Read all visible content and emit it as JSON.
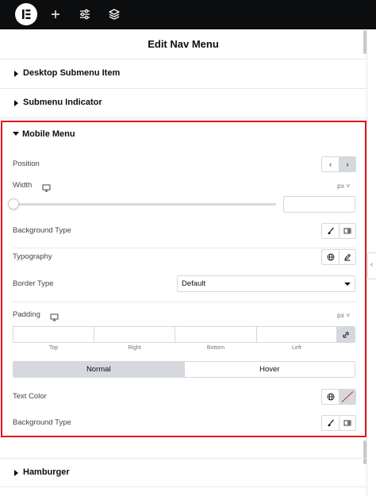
{
  "topbar": {
    "logo_icon": "elementor-logo-icon",
    "add_icon": "plus-icon",
    "settings_icon": "sliders-icon",
    "structure_icon": "layers-icon"
  },
  "panel": {
    "title": "Edit Nav Menu"
  },
  "sections": {
    "desktop_submenu": "Desktop Submenu Item",
    "submenu_indicator": "Submenu Indicator",
    "mobile_menu": "Mobile Menu",
    "hamburger": "Hamburger"
  },
  "mobile_menu": {
    "position": {
      "label": "Position",
      "options": [
        "‹",
        "›"
      ],
      "selected": "›"
    },
    "width": {
      "label": "Width",
      "unit": "px",
      "device_icon": "desktop-icon",
      "value": "",
      "slider_value": 0
    },
    "background_type_1": {
      "label": "Background Type",
      "icons": [
        "brush-icon",
        "gradient-icon"
      ]
    },
    "typography": {
      "label": "Typography",
      "icons": [
        "globe-icon",
        "pencil-icon"
      ]
    },
    "border_type": {
      "label": "Border Type",
      "value": "Default"
    },
    "padding": {
      "label": "Padding",
      "unit": "px",
      "device_icon": "desktop-icon",
      "fields": [
        "Top",
        "Right",
        "Bottom",
        "Left"
      ],
      "link_icon": "link-icon"
    },
    "state_tabs": [
      "Normal",
      "Hover"
    ],
    "active_state": "Normal",
    "text_color": {
      "label": "Text Color",
      "icons": [
        "globe-icon",
        "no-color-swatch-icon"
      ]
    },
    "background_type_2": {
      "label": "Background Type",
      "icons": [
        "brush-icon",
        "gradient-icon"
      ]
    }
  },
  "colors": {
    "highlight_border": "#e3141c",
    "topbar_bg": "#0c0d0e"
  }
}
